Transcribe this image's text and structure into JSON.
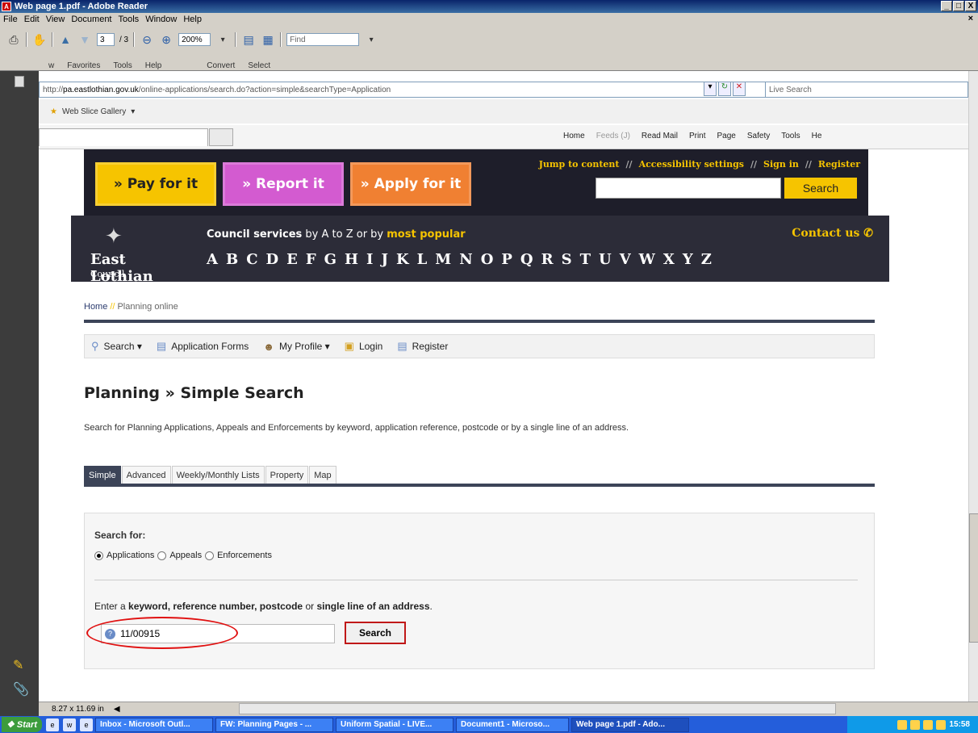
{
  "window": {
    "title": "Web page 1.pdf - Adobe Reader",
    "min": "_",
    "max": "□",
    "close": "X",
    "doc_close": "×"
  },
  "menubar": [
    "File",
    "Edit",
    "View",
    "Document",
    "Tools",
    "Window",
    "Help"
  ],
  "reader_toolbar": {
    "page_current": "3",
    "page_total": "/ 3",
    "zoom": "200%",
    "find_placeholder": "Find"
  },
  "ie": {
    "partial_menu": [
      "w",
      "Favorites",
      "Tools",
      "Help"
    ],
    "convert": "Convert",
    "select": "Select",
    "url_prefix": "http://",
    "url_host": "pa.eastlothian.gov.uk",
    "url_path": "/online-applications/search.do?action=simple&searchType=Application",
    "live_search": "Live Search",
    "web_slice": "Web Slice Gallery",
    "cmd_items": [
      "Home",
      "Feeds (J)",
      "Read Mail",
      "Print",
      "Page",
      "Safety",
      "Tools",
      "He"
    ]
  },
  "site": {
    "actions": {
      "pay": "» Pay for it",
      "report": "» Report it",
      "apply": "» Apply for it"
    },
    "toplinks": [
      "Jump to content",
      "Accessibility settings",
      "Sign in",
      "Register"
    ],
    "toplink_sep": "//",
    "search_button": "Search",
    "logo_name": "East Lothian",
    "logo_council": "Council",
    "services_bold": "Council services",
    "services_mid": " by A to Z or by ",
    "services_popular": "most popular",
    "contact": "Contact us",
    "az": [
      "A",
      "B",
      "C",
      "D",
      "E",
      "F",
      "G",
      "H",
      "I",
      "J",
      "K",
      "L",
      "M",
      "N",
      "O",
      "P",
      "Q",
      "R",
      "S",
      "T",
      "U",
      "V",
      "W",
      "X",
      "Y",
      "Z"
    ]
  },
  "breadcrumb": {
    "home": "Home",
    "sep": "//",
    "current": "Planning online"
  },
  "subnav": {
    "search": "Search ▾",
    "forms": "Application Forms",
    "profile": "My Profile ▾",
    "login": "Login",
    "register": "Register"
  },
  "main": {
    "title": "Planning » Simple Search",
    "intro": "Search for Planning Applications, Appeals and Enforcements by keyword, application reference, postcode or by a single line of an address.",
    "tabs": [
      "Simple",
      "Advanced",
      "Weekly/Monthly Lists",
      "Property",
      "Map"
    ],
    "search_for": "Search for:",
    "radios": [
      "Applications",
      "Appeals",
      "Enforcements"
    ],
    "enter_1": "Enter a ",
    "enter_b1": "keyword, reference number, postcode",
    "enter_2": " or ",
    "enter_b2": "single line of an address",
    "enter_3": ".",
    "query": "11/00915",
    "search_button": "Search"
  },
  "status": {
    "page_size": "8.27 x 11.69 in"
  },
  "taskbar": {
    "start": "Start",
    "tasks": [
      "Inbox - Microsoft Outl...",
      "FW: Planning Pages - ...",
      "Uniform Spatial - LIVE...",
      "Document1 - Microso...",
      "Web page 1.pdf - Ado..."
    ],
    "clock": "15:58"
  }
}
